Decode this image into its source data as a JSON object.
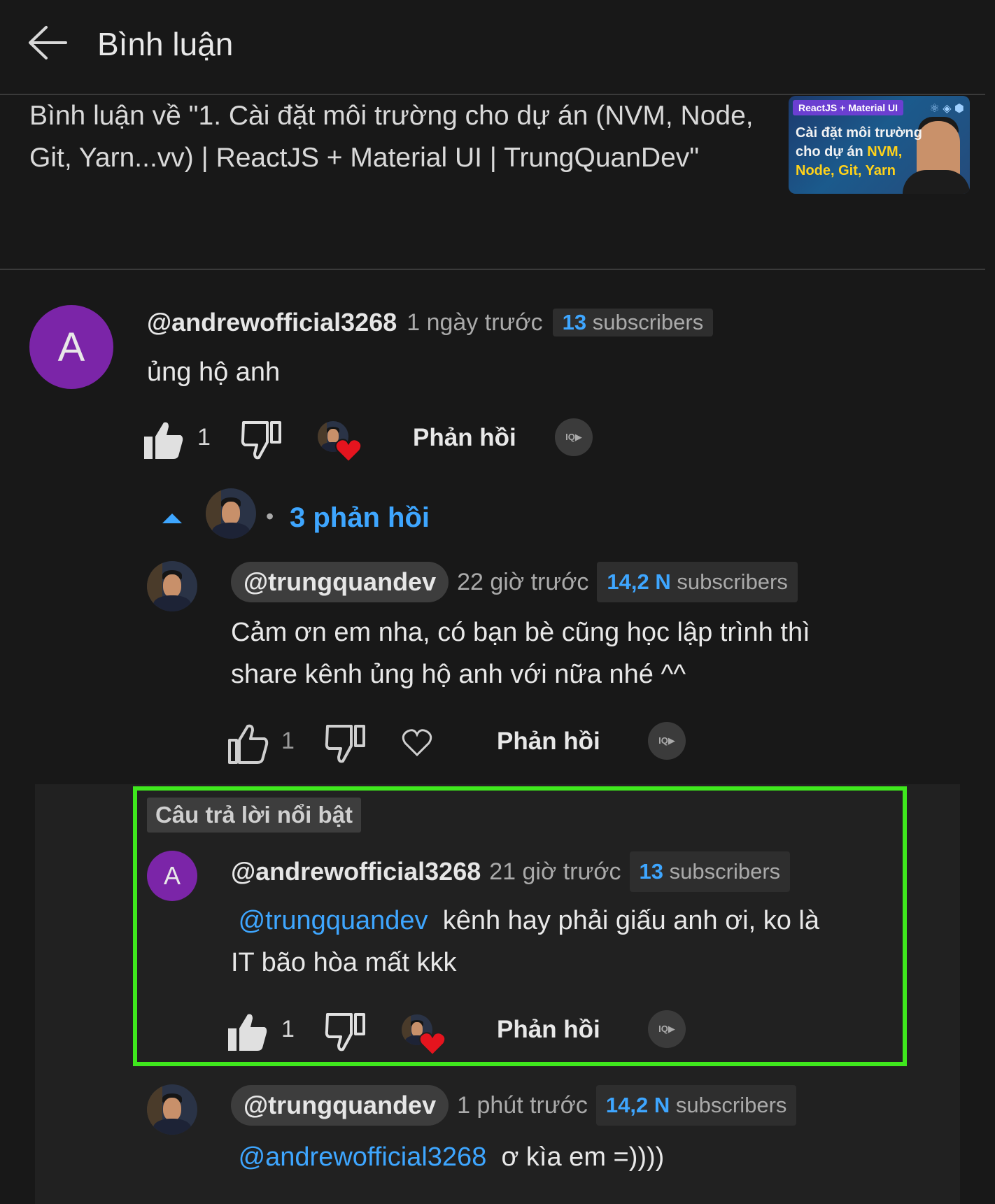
{
  "header": {
    "title": "Bình luận",
    "video_title": "Bình luận về \"1. Cài đặt môi trường cho dự án (NVM, Node, Git, Yarn...vv) | ReactJS + Material UI | TrungQuanDev\""
  },
  "thumbnail": {
    "tag": "ReactJS + Material UI",
    "line1": "Cài đặt môi trường",
    "line2_prefix": "cho dự án ",
    "line2_highlight": "NVM,",
    "line3": "Node, Git, Yarn"
  },
  "comments": {
    "top": {
      "avatar_letter": "A",
      "author": "@andrewofficial3268",
      "time": "1 ngày trước",
      "subs_number": "13",
      "subs_label": "subscribers",
      "text": "ủng hộ anh",
      "likes": "1",
      "reply_label": "Phản hồi"
    },
    "replies_toggle": "3 phản hồi",
    "reply1": {
      "author": "@trungquandev",
      "time": "22 giờ trước",
      "subs_number": "14,2 N",
      "subs_label": "subscribers",
      "text_line1": "Cảm ơn em nha, có bạn bè cũng học lập trình thì",
      "text_line2": "share kênh ủng hộ anh với nữa nhé ^^",
      "likes": "1",
      "reply_label": "Phản hồi"
    },
    "reply2": {
      "badge": "Câu trả lời nổi bật",
      "avatar_letter": "A",
      "author": "@andrewofficial3268",
      "time": "21 giờ trước",
      "subs_number": "13",
      "subs_label": "subscribers",
      "mention": "@trungquandev",
      "text_line1_rest": "kênh hay phải giấu anh ơi, ko là",
      "text_line2": "IT bão hòa mất kkk",
      "likes": "1",
      "reply_label": "Phản hồi"
    },
    "reply3": {
      "author": "@trungquandev",
      "time": "1 phút trước",
      "subs_number": "14,2 N",
      "subs_label": "subscribers",
      "mention": "@andrewofficial3268",
      "text_rest": "ơ kìa em =))))"
    }
  },
  "icons": {
    "back": "arrow-left-icon",
    "like": "thumbs-up-icon",
    "dislike": "thumbs-down-icon",
    "heart": "heart-icon",
    "iq": "iq-icon"
  },
  "colors": {
    "background": "#181818",
    "accent_blue": "#3ea6ff",
    "highlight_border": "#3fe81d",
    "avatar_purple": "#7b25a8",
    "heart_red": "#e5141e"
  }
}
